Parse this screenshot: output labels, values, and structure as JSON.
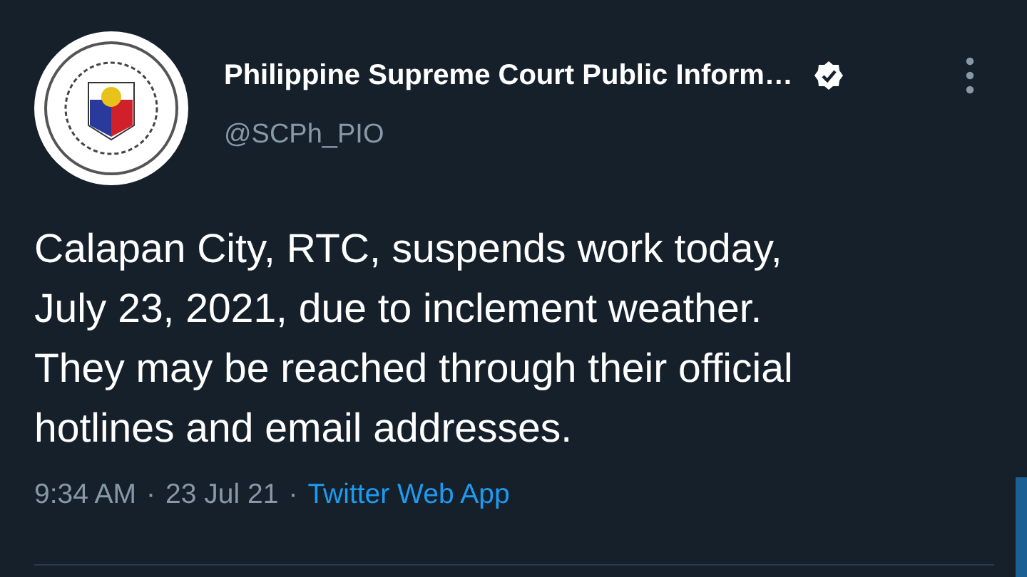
{
  "tweet": {
    "author": {
      "name": "Philippine Supreme Court Public Inform…",
      "verified": true,
      "handle": "@SCPh_PIO"
    },
    "body_lines": [
      "Calapan City, RTC, suspends work today,",
      "July 23, 2021, due to inclement weather.",
      "They may be reached through their official",
      "hotlines and email addresses."
    ],
    "meta": [
      {
        "text": "9:34 AM",
        "kind": "plain"
      },
      {
        "text": "·",
        "kind": "separator"
      },
      {
        "text": "23 Jul 21",
        "kind": "plain"
      },
      {
        "text": "·",
        "kind": "separator"
      },
      {
        "text": "Twitter Web App",
        "kind": "link"
      }
    ]
  }
}
